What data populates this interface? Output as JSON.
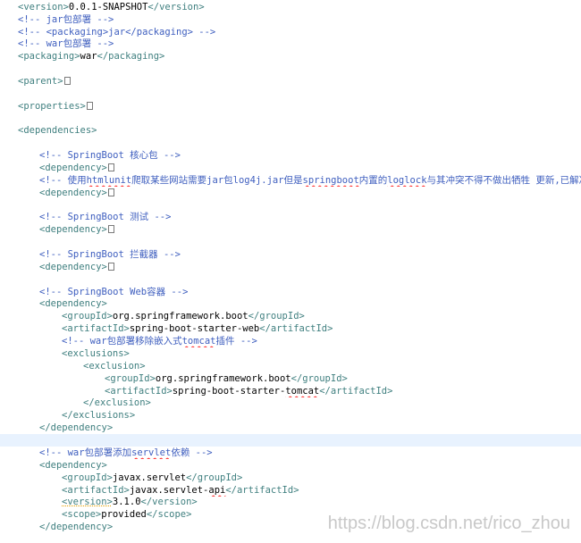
{
  "editor": {
    "lines": {
      "l1": {
        "a": "<version>",
        "b": "0.0.1-SNAPSHOT",
        "c": "</version>"
      },
      "l2": {
        "a": "<!-- jar包部署 -->"
      },
      "l3": {
        "a": "<!-- <packaging>jar</packaging> -->"
      },
      "l4": {
        "a": "<!-- war包部署 -->"
      },
      "l5": {
        "a": "<packaging>",
        "b": "war",
        "c": "</packaging>"
      },
      "l7": {
        "a": "<parent>"
      },
      "l9": {
        "a": "<properties>"
      },
      "l11": {
        "a": "<dependencies>"
      },
      "l13": {
        "a": "<!-- SpringBoot 核心包 -->"
      },
      "l14": {
        "a": "<dependency>"
      },
      "l15": {
        "a": "<!-- 使用",
        "u1": "htmlunit",
        "b": "爬取某些网站需要jar包log4j.jar但是",
        "u2": "springboot",
        "c": "内置的",
        "u3": "loglock",
        "d": "与其冲突不得不做出牺牲 更新,已解决,不"
      },
      "l16": {
        "a": "<dependency>"
      },
      "l18": {
        "a": "<!-- SpringBoot 测试 -->"
      },
      "l19": {
        "a": "<dependency>"
      },
      "l21": {
        "a": "<!-- SpringBoot 拦截器 -->"
      },
      "l22": {
        "a": "<dependency>"
      },
      "l24": {
        "a": "<!-- SpringBoot Web容器 -->"
      },
      "l25": {
        "a": "<dependency>"
      },
      "l26": {
        "a": "<groupId>",
        "b": "org.springframework.boot",
        "c": "</groupId>"
      },
      "l27": {
        "a": "<artifactId>",
        "b": "spring-boot-starter-web",
        "c": "</artifactId>"
      },
      "l28": {
        "a": "<!-- war包部署移除嵌入式",
        "u1": "tomcat",
        "b": "插件 -->"
      },
      "l29": {
        "a": "<exclusions>"
      },
      "l30": {
        "a": "<exclusion>"
      },
      "l31": {
        "a": "<groupId>",
        "b": "org.springframework.boot",
        "c": "</groupId>"
      },
      "l32": {
        "a": "<artifactId>",
        "b": "spring-boot-starter-",
        "u1": "tomcat",
        "c": "</artifactId>"
      },
      "l33": {
        "a": "</exclusion>"
      },
      "l34": {
        "a": "</exclusions>"
      },
      "l35": {
        "a": "</dependency>"
      },
      "l37": {
        "a": "<!-- war包部署添加",
        "u1": "servlet",
        "b": "依赖 -->"
      },
      "l38": {
        "a": "<dependency>"
      },
      "l39": {
        "a": "<groupId>",
        "b": "javax.servlet",
        "c": "</groupId>"
      },
      "l40": {
        "a": "<artifactId>",
        "b": "javax.servlet-",
        "u1": "api",
        "c": "</artifactId>"
      },
      "l41": {
        "a": "<version>",
        "b": "3.1.0",
        "c": "</version>"
      },
      "l42": {
        "a": "<scope>",
        "b": "provided",
        "c": "</scope>"
      },
      "l43": {
        "a": "</dependency>"
      }
    }
  },
  "watermark": "https://blog.csdn.net/rico_zhou"
}
